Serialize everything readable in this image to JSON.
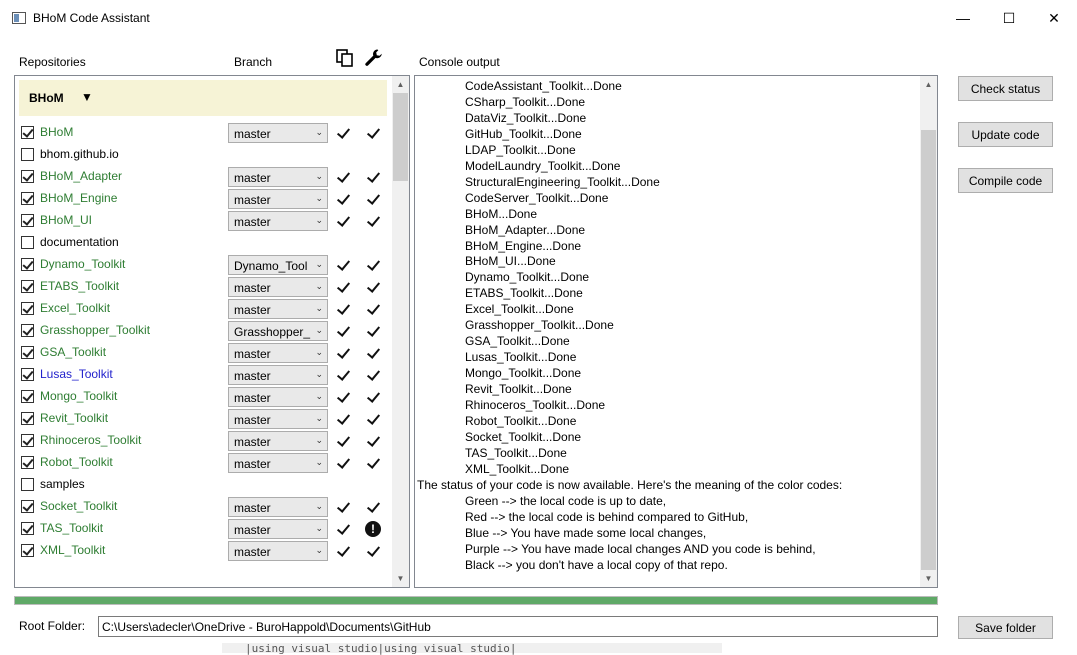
{
  "window": {
    "title": "BHoM Code Assistant",
    "minimize_glyph": "—",
    "maximize_glyph": "☐",
    "close_glyph": "✕"
  },
  "headers": {
    "repositories": "Repositories",
    "branch": "Branch",
    "console": "Console output",
    "copy_icon": "copy-icon",
    "wrench_icon": "wrench-icon"
  },
  "group": {
    "label": "BHoM",
    "arrow": "▼"
  },
  "repos": [
    {
      "name": "BHoM",
      "checked": true,
      "branch": "master",
      "status": "check",
      "color": "#2e7d32"
    },
    {
      "name": "bhom.github.io",
      "checked": false,
      "branch": "",
      "status": "",
      "color": "#000000"
    },
    {
      "name": "BHoM_Adapter",
      "checked": true,
      "branch": "master",
      "status": "check",
      "color": "#2e7d32"
    },
    {
      "name": "BHoM_Engine",
      "checked": true,
      "branch": "master",
      "status": "check",
      "color": "#2e7d32"
    },
    {
      "name": "BHoM_UI",
      "checked": true,
      "branch": "master",
      "status": "check",
      "color": "#2e7d32"
    },
    {
      "name": "documentation",
      "checked": false,
      "branch": "",
      "status": "",
      "color": "#000000"
    },
    {
      "name": "Dynamo_Toolkit",
      "checked": true,
      "branch": "Dynamo_Tool",
      "status": "check",
      "color": "#2e7d32"
    },
    {
      "name": "ETABS_Toolkit",
      "checked": true,
      "branch": "master",
      "status": "check",
      "color": "#2e7d32"
    },
    {
      "name": "Excel_Toolkit",
      "checked": true,
      "branch": "master",
      "status": "check",
      "color": "#2e7d32"
    },
    {
      "name": "Grasshopper_Toolkit",
      "checked": true,
      "branch": "Grasshopper_",
      "status": "check",
      "color": "#2e7d32"
    },
    {
      "name": "GSA_Toolkit",
      "checked": true,
      "branch": "master",
      "status": "check",
      "color": "#2e7d32"
    },
    {
      "name": "Lusas_Toolkit",
      "checked": true,
      "branch": "master",
      "status": "check",
      "color": "#2222cc"
    },
    {
      "name": "Mongo_Toolkit",
      "checked": true,
      "branch": "master",
      "status": "check",
      "color": "#2e7d32"
    },
    {
      "name": "Revit_Toolkit",
      "checked": true,
      "branch": "master",
      "status": "check",
      "color": "#2e7d32"
    },
    {
      "name": "Rhinoceros_Toolkit",
      "checked": true,
      "branch": "master",
      "status": "check",
      "color": "#2e7d32"
    },
    {
      "name": "Robot_Toolkit",
      "checked": true,
      "branch": "master",
      "status": "check",
      "color": "#2e7d32"
    },
    {
      "name": "samples",
      "checked": false,
      "branch": "",
      "status": "",
      "color": "#000000"
    },
    {
      "name": "Socket_Toolkit",
      "checked": true,
      "branch": "master",
      "status": "check",
      "color": "#2e7d32"
    },
    {
      "name": "TAS_Toolkit",
      "checked": true,
      "branch": "master",
      "status": "warning",
      "color": "#2e7d32"
    },
    {
      "name": "XML_Toolkit",
      "checked": true,
      "branch": "master",
      "status": "check",
      "color": "#2e7d32"
    }
  ],
  "warning_glyph": "!",
  "dropdown_glyph": "⌄",
  "console_lines": [
    {
      "text": "CodeAssistant_Toolkit...Done",
      "indent": true
    },
    {
      "text": "CSharp_Toolkit...Done",
      "indent": true
    },
    {
      "text": "DataViz_Toolkit...Done",
      "indent": true
    },
    {
      "text": "GitHub_Toolkit...Done",
      "indent": true
    },
    {
      "text": "LDAP_Toolkit...Done",
      "indent": true
    },
    {
      "text": "ModelLaundry_Toolkit...Done",
      "indent": true
    },
    {
      "text": "StructuralEngineering_Toolkit...Done",
      "indent": true
    },
    {
      "text": "CodeServer_Toolkit...Done",
      "indent": true
    },
    {
      "text": "BHoM...Done",
      "indent": true
    },
    {
      "text": "BHoM_Adapter...Done",
      "indent": true
    },
    {
      "text": "BHoM_Engine...Done",
      "indent": true
    },
    {
      "text": "BHoM_UI...Done",
      "indent": true
    },
    {
      "text": "Dynamo_Toolkit...Done",
      "indent": true
    },
    {
      "text": "ETABS_Toolkit...Done",
      "indent": true
    },
    {
      "text": "Excel_Toolkit...Done",
      "indent": true
    },
    {
      "text": "Grasshopper_Toolkit...Done",
      "indent": true
    },
    {
      "text": "GSA_Toolkit...Done",
      "indent": true
    },
    {
      "text": "Lusas_Toolkit...Done",
      "indent": true
    },
    {
      "text": "Mongo_Toolkit...Done",
      "indent": true
    },
    {
      "text": "Revit_Toolkit...Done",
      "indent": true
    },
    {
      "text": "Rhinoceros_Toolkit...Done",
      "indent": true
    },
    {
      "text": "Robot_Toolkit...Done",
      "indent": true
    },
    {
      "text": "Socket_Toolkit...Done",
      "indent": true
    },
    {
      "text": "TAS_Toolkit...Done",
      "indent": true
    },
    {
      "text": "XML_Toolkit...Done",
      "indent": true
    },
    {
      "text": "The status of your code is now available. Here's the meaning of the color codes:",
      "indent": false
    },
    {
      "text": "Green --> the local code is up to date,",
      "indent": true
    },
    {
      "text": "Red --> the local code is behind compared to GitHub,",
      "indent": true
    },
    {
      "text": "Blue --> You have made some local changes,",
      "indent": true
    },
    {
      "text": "Purple --> You have made local changes AND you code is behind,",
      "indent": true
    },
    {
      "text": "Black --> you don't have a local copy of that repo.",
      "indent": true
    }
  ],
  "buttons": {
    "check_status": "Check status",
    "update_code": "Update code",
    "compile_code": "Compile code",
    "save_folder": "Save folder"
  },
  "progress": {
    "fraction": 1.0,
    "color": "#5fa967"
  },
  "root_folder": {
    "label": "Root Folder:",
    "value": "C:\\Users\\adecler\\OneDrive - BuroHappold\\Documents\\GitHub"
  },
  "background_text": "|using visual studio|using visual studio|",
  "scroll_arrows": {
    "up": "▲",
    "down": "▼"
  }
}
